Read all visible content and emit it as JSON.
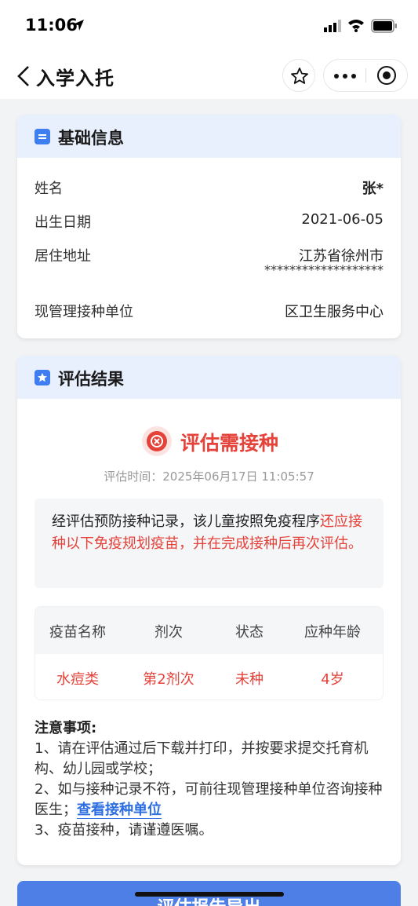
{
  "status_bar": {
    "time": "11:06"
  },
  "nav": {
    "title": "入学入托"
  },
  "basic_info": {
    "title": "基础信息",
    "rows": [
      {
        "label": "姓名",
        "value": "张*"
      },
      {
        "label": "出生日期",
        "value": "2021-06-05"
      },
      {
        "label": "居住地址",
        "value": "江苏省徐州市",
        "extra": "*******************"
      },
      {
        "label": "现管理接种单位",
        "value": "区卫生服务中心"
      }
    ]
  },
  "assessment": {
    "title": "评估结果",
    "status": "评估需接种",
    "eval_time": "评估时间：2025年06月17日 11:05:57",
    "notice_normal": "经评估预防接种记录，该儿童按照免疫程序",
    "notice_red": "还应接种以下免疫规划疫苗，并在完成接种后再次评估。",
    "table": {
      "headers": [
        "疫苗名称",
        "剂次",
        "状态",
        "应种年龄"
      ],
      "rows": [
        [
          "水痘类",
          "第2剂次",
          "未种",
          "4岁"
        ]
      ]
    },
    "notes": {
      "title": "注意事项:",
      "item1": "1、请在评估通过后下载并打印，并按要求提交托育机构、幼儿园或学校；",
      "item2": "2、如与接种记录不符，可前往现管理接种单位咨询接种医生；",
      "item2_link": "查看接种单位",
      "item3": "3、疫苗接种，请谨遵医嘱。"
    }
  },
  "export_button": "评估报告导出",
  "colors": {
    "accent": "#3f7ef0",
    "danger": "#e5423a",
    "link": "#2d6ee0",
    "header_bg": "#e8effd"
  }
}
